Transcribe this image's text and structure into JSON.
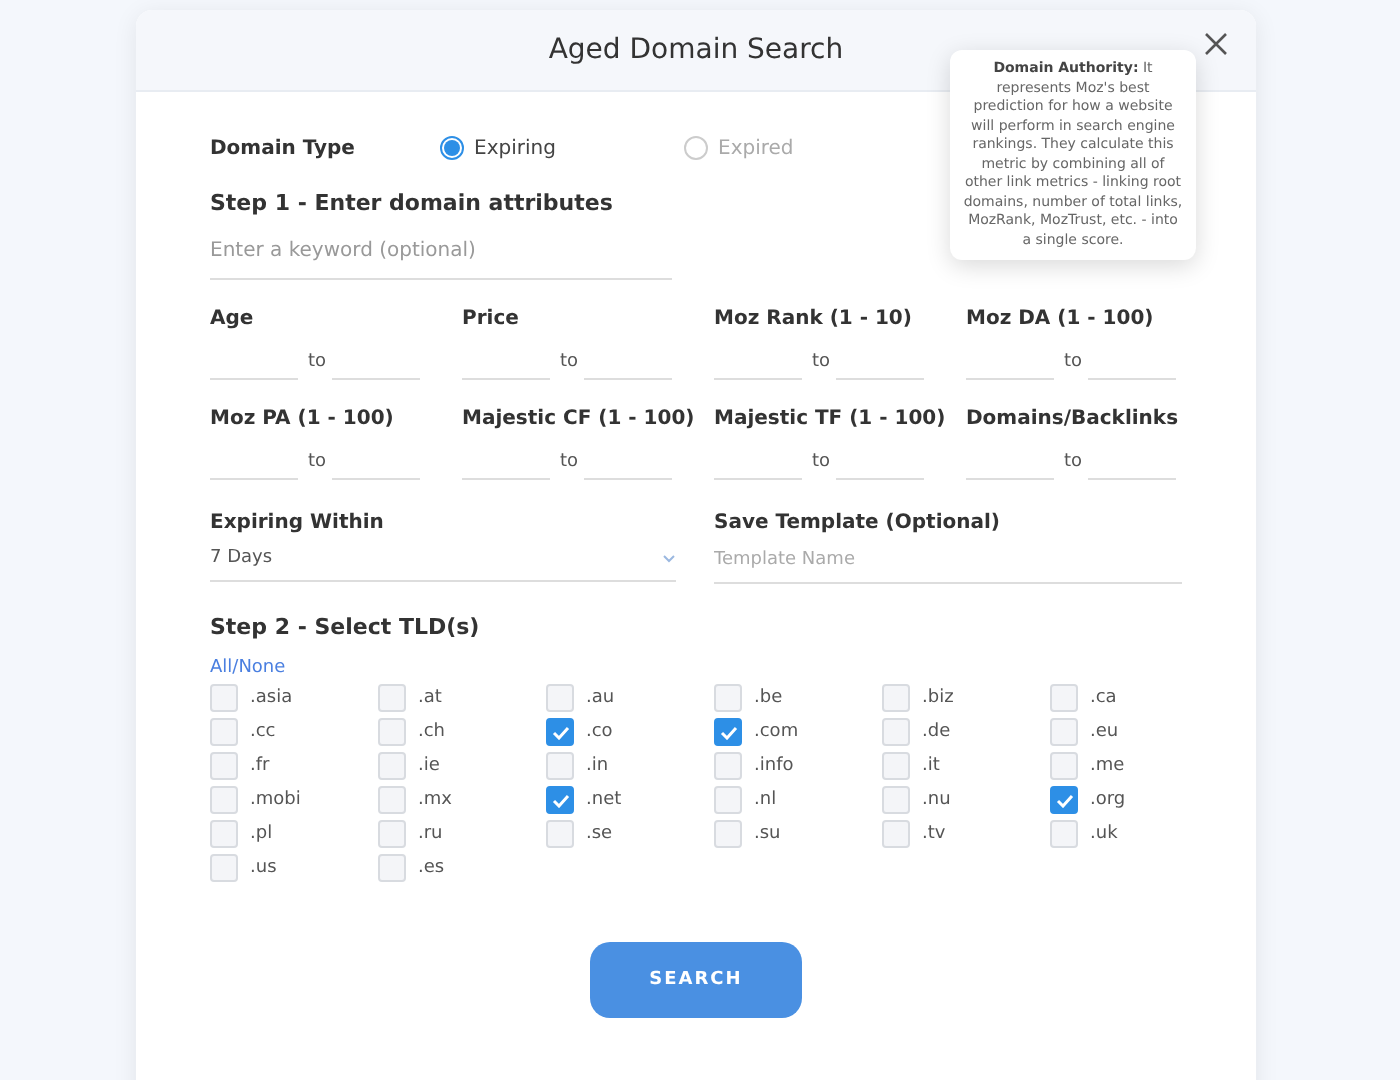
{
  "modal": {
    "title": "Aged Domain Search"
  },
  "tooltip": {
    "text": "**Domain Authority:** It represents Moz's best prediction for how a website will perform in search engine rankings. They calculate this metric by combining all of other link metrics - linking root domains, number of total links, MozRank, MozTrust, etc. - into a single score."
  },
  "domain_type": {
    "label": "Domain Type",
    "options": [
      {
        "label": "Expiring",
        "selected": true
      },
      {
        "label": "Expired",
        "selected": false
      }
    ]
  },
  "step1": {
    "title": "Step 1 - Enter domain attributes",
    "keyword": {
      "placeholder": "Enter a keyword (optional)"
    },
    "ranges": [
      {
        "label": "Age",
        "separator": "to"
      },
      {
        "label": "Price",
        "separator": "to"
      },
      {
        "label": "Moz Rank (1 - 10)",
        "separator": "to"
      },
      {
        "label": "Moz DA (1 - 100)",
        "separator": "to"
      },
      {
        "label": "Moz PA (1 - 100)",
        "separator": "to"
      },
      {
        "label": "Majestic CF (1 - 100)",
        "separator": "to"
      },
      {
        "label": "Majestic TF (1 - 100)",
        "separator": "to"
      },
      {
        "label": "Domains/Backlinks",
        "separator": "to"
      }
    ],
    "expiring_within": {
      "label": "Expiring Within",
      "value": "7 Days"
    },
    "template": {
      "label": "Save Template (Optional)",
      "placeholder": "Template Name"
    }
  },
  "step2": {
    "title": "Step 2 - Select TLD(s)",
    "toggle_all": "All/None",
    "tlds": [
      {
        "label": ".asia",
        "checked": false
      },
      {
        "label": ".at",
        "checked": false
      },
      {
        "label": ".au",
        "checked": false
      },
      {
        "label": ".be",
        "checked": false
      },
      {
        "label": ".biz",
        "checked": false
      },
      {
        "label": ".ca",
        "checked": false
      },
      {
        "label": ".cc",
        "checked": false
      },
      {
        "label": ".ch",
        "checked": false
      },
      {
        "label": ".co",
        "checked": true
      },
      {
        "label": ".com",
        "checked": true
      },
      {
        "label": ".de",
        "checked": false
      },
      {
        "label": ".eu",
        "checked": false
      },
      {
        "label": ".fr",
        "checked": false
      },
      {
        "label": ".ie",
        "checked": false
      },
      {
        "label": ".in",
        "checked": false
      },
      {
        "label": ".info",
        "checked": false
      },
      {
        "label": ".it",
        "checked": false
      },
      {
        "label": ".me",
        "checked": false
      },
      {
        "label": ".mobi",
        "checked": false
      },
      {
        "label": ".mx",
        "checked": false
      },
      {
        "label": ".net",
        "checked": true
      },
      {
        "label": ".nl",
        "checked": false
      },
      {
        "label": ".nu",
        "checked": false
      },
      {
        "label": ".org",
        "checked": true
      },
      {
        "label": ".pl",
        "checked": false
      },
      {
        "label": ".ru",
        "checked": false
      },
      {
        "label": ".se",
        "checked": false
      },
      {
        "label": ".su",
        "checked": false
      },
      {
        "label": ".tv",
        "checked": false
      },
      {
        "label": ".uk",
        "checked": false
      },
      {
        "label": ".us",
        "checked": false
      },
      {
        "label": ".es",
        "checked": false
      }
    ]
  },
  "search_button": "SEARCH"
}
